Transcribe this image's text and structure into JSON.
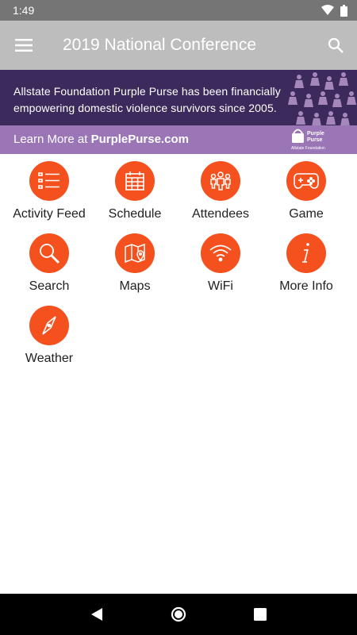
{
  "status_bar": {
    "time": "1:49",
    "wifi_icon": "wifi-icon",
    "battery_icon": "battery-icon"
  },
  "app_bar": {
    "title": "2019 National Conference",
    "menu_icon": "menu-icon",
    "search_icon": "search-icon"
  },
  "banner": {
    "line1": "Allstate Foundation Purple Purse has been financially",
    "line2": "empowering domestic violence survivors since 2005.",
    "learn_more_prefix": "Learn More at ",
    "learn_more_link": "PurplePurse.com",
    "logo_line1": "Purple",
    "logo_line2": "Purse",
    "logo_sub": "Allstate Foundation",
    "colors": {
      "top": "#3c2a5c",
      "bottom": "#9b76b7"
    }
  },
  "tiles": [
    {
      "label": "Activity Feed",
      "icon": "activity-feed-icon"
    },
    {
      "label": "Schedule",
      "icon": "calendar-icon"
    },
    {
      "label": "Attendees",
      "icon": "attendees-icon"
    },
    {
      "label": "Game",
      "icon": "gamepad-icon"
    },
    {
      "label": "Search",
      "icon": "magnifier-icon"
    },
    {
      "label": "Maps",
      "icon": "map-icon"
    },
    {
      "label": "WiFi",
      "icon": "wifi-icon"
    },
    {
      "label": "More Info",
      "icon": "info-icon"
    },
    {
      "label": "Weather",
      "icon": "compass-icon"
    }
  ],
  "theme": {
    "accent": "#f4511e",
    "app_bar": "#bdbdbd",
    "status_bar": "#757575"
  },
  "nav_bar": {
    "back_icon": "back-icon",
    "home_icon": "home-icon",
    "recents_icon": "recents-icon"
  }
}
